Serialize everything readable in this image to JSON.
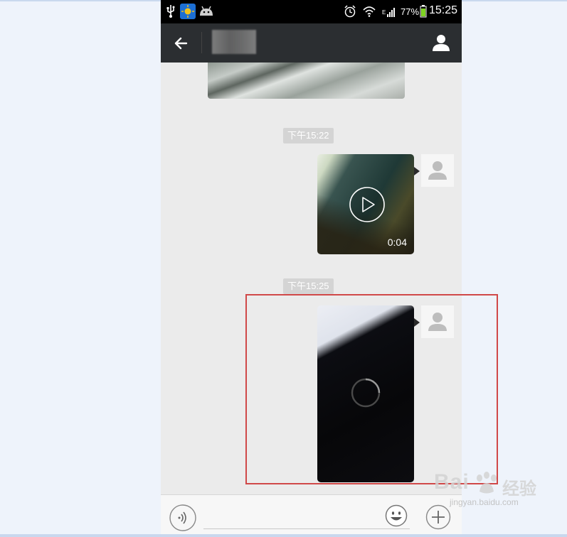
{
  "status_bar": {
    "battery": "77%",
    "time": "15:25",
    "network_type": "E",
    "icons": [
      "usb-icon",
      "weather-app-icon",
      "android-icon",
      "alarm-icon",
      "wifi-icon",
      "signal-icon",
      "battery-icon"
    ]
  },
  "header": {
    "back_icon": "back-arrow-icon",
    "profile_icon": "profile-icon"
  },
  "messages": [
    {
      "type": "timestamp",
      "text": "下午15:22"
    },
    {
      "type": "video",
      "duration": "0:04",
      "state": "ready"
    },
    {
      "type": "timestamp",
      "text": "下午15:25"
    },
    {
      "type": "video",
      "duration": "",
      "state": "loading"
    }
  ],
  "input_bar": {
    "voice_icon": "voice-icon",
    "emoji_icon": "emoji-icon",
    "plus_icon": "plus-icon"
  },
  "watermark": {
    "brand": "Bai",
    "suffix": "经验",
    "sub": "jingyan.baidu.com"
  },
  "colors": {
    "highlight_box": "#d04848",
    "title_bar": "#2b2e31",
    "chat_bg": "#ebebeb"
  }
}
